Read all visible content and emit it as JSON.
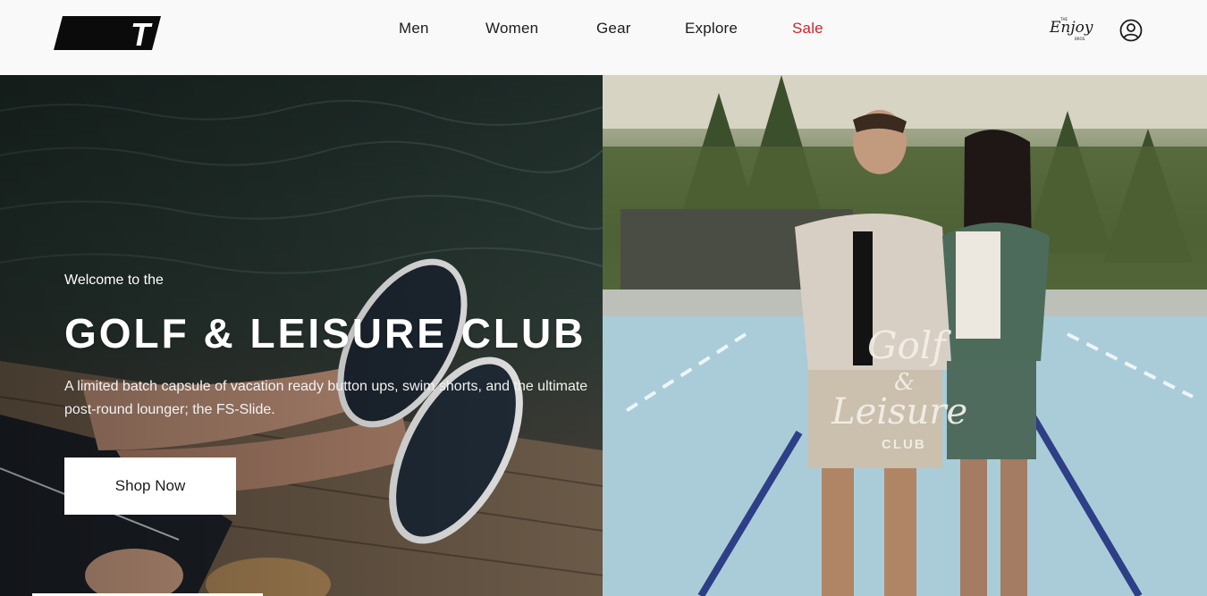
{
  "header": {
    "logo_letter": "T",
    "nav": [
      {
        "label": "Men"
      },
      {
        "label": "Women"
      },
      {
        "label": "Gear"
      },
      {
        "label": "Explore"
      },
      {
        "label": "Sale",
        "color": "#d0232b"
      }
    ],
    "partner_logo": {
      "small_top": "THE",
      "script": "Enjoy",
      "small_bottom": "BROS."
    }
  },
  "hero": {
    "welcome": "Welcome to the",
    "title": "GOLF & LEISURE CLUB",
    "description": "A limited batch capsule of vacation ready button ups, swim shorts, and the ultimate post-round lounger; the FS-Slide.",
    "cta_label": "Shop Now",
    "graphic_text": {
      "line1": "Golf",
      "line2": "&",
      "line3": "Leisure",
      "line4": "CLUB"
    }
  },
  "colors": {
    "sale": "#d0232b",
    "header_bg": "#f9f9f9"
  },
  "icons": [
    "brand-logo-icon",
    "account-icon"
  ]
}
